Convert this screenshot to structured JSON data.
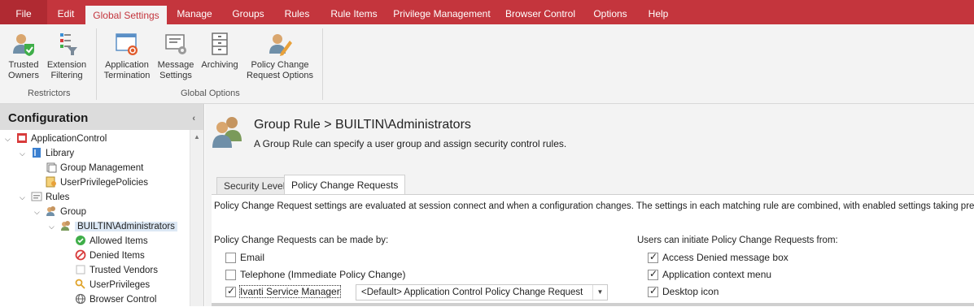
{
  "menu": {
    "tabs": [
      "File",
      "Edit",
      "Global Settings",
      "Manage",
      "Groups",
      "Rules",
      "Rule Items",
      "Privilege Management",
      "Browser Control",
      "Options",
      "Help"
    ],
    "active": "Global Settings"
  },
  "ribbon": {
    "restrictors": {
      "label": "Restrictors",
      "trusted_owners": [
        "Trusted",
        "Owners"
      ],
      "extension_filtering": [
        "Extension",
        "Filtering"
      ]
    },
    "global_options": {
      "label": "Global Options",
      "application_termination": [
        "Application",
        "Termination"
      ],
      "message_settings": [
        "Message",
        "Settings"
      ],
      "archiving": [
        "Archiving"
      ],
      "policy_change": [
        "Policy Change",
        "Request Options"
      ]
    }
  },
  "sidebar": {
    "title": "Configuration",
    "tree": {
      "root": "ApplicationControl",
      "library": "Library",
      "group_management": "Group Management",
      "user_privilege_policies": "UserPrivilegePolicies",
      "rules": "Rules",
      "group": "Group",
      "builtin_admins": "BUILTIN\\Administrators",
      "allowed_items": "Allowed Items",
      "denied_items": "Denied Items",
      "trusted_vendors": "Trusted Vendors",
      "user_privileges": "UserPrivileges",
      "browser_control": "Browser Control"
    }
  },
  "main": {
    "title": "Group Rule > BUILTIN\\Administrators",
    "subtitle": "A Group Rule can specify a user group and assign security control rules.",
    "tabs": [
      {
        "label": "Security Level",
        "active": false
      },
      {
        "label": "Policy Change Requests",
        "active": true
      }
    ],
    "description": "Policy Change Request settings are evaluated at session connect and when a configuration changes. The settings in each matching rule are combined, with enabled settings taking precedence.",
    "made_by": {
      "heading": "Policy Change Requests can be made by:",
      "options": [
        {
          "label": "Email",
          "checked": false
        },
        {
          "label": "Telephone (Immediate Policy Change)",
          "checked": false
        },
        {
          "label": "Ivanti Service Manager",
          "checked": true
        }
      ],
      "combo_value": "<Default> Application Control Policy Change Request"
    },
    "initiate_from": {
      "heading": "Users can initiate Policy Change Requests from:",
      "options": [
        {
          "label": "Access Denied message box",
          "checked": true
        },
        {
          "label": "Application context menu",
          "checked": true
        },
        {
          "label": "Desktop icon",
          "checked": true
        }
      ]
    }
  },
  "colors": {
    "accent": "#c4353d",
    "ribbon_bg": "#f3f3f3",
    "selection": "#dce8f5"
  }
}
